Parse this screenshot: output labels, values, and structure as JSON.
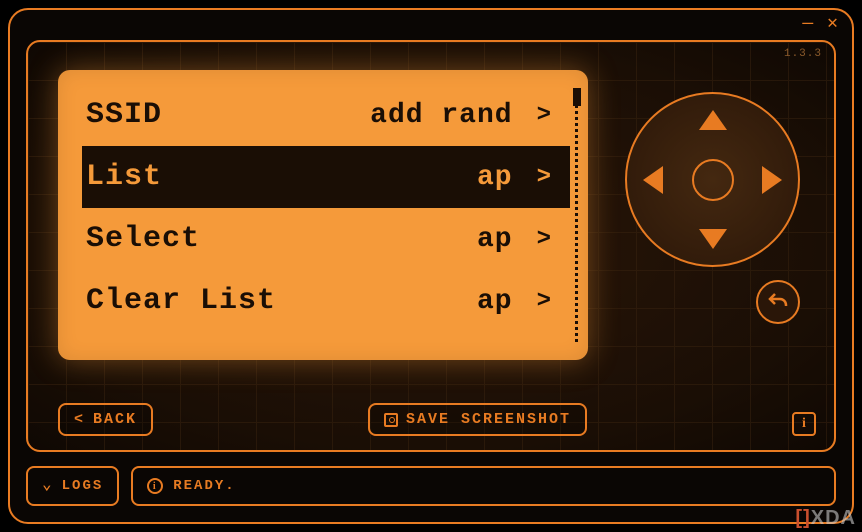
{
  "version": "1.3.3",
  "menu": {
    "selected_index": 1,
    "items": [
      {
        "label": "SSID",
        "value": "add rand",
        "chevron": ">"
      },
      {
        "label": "List",
        "value": "ap",
        "chevron": ">"
      },
      {
        "label": "Select",
        "value": "ap",
        "chevron": ">"
      },
      {
        "label": "Clear List",
        "value": "ap",
        "chevron": ">"
      }
    ]
  },
  "buttons": {
    "back": "BACK",
    "save_screenshot": "SAVE SCREENSHOT",
    "logs": "LOGS"
  },
  "status": {
    "text": "READY."
  },
  "watermark": "XDA"
}
